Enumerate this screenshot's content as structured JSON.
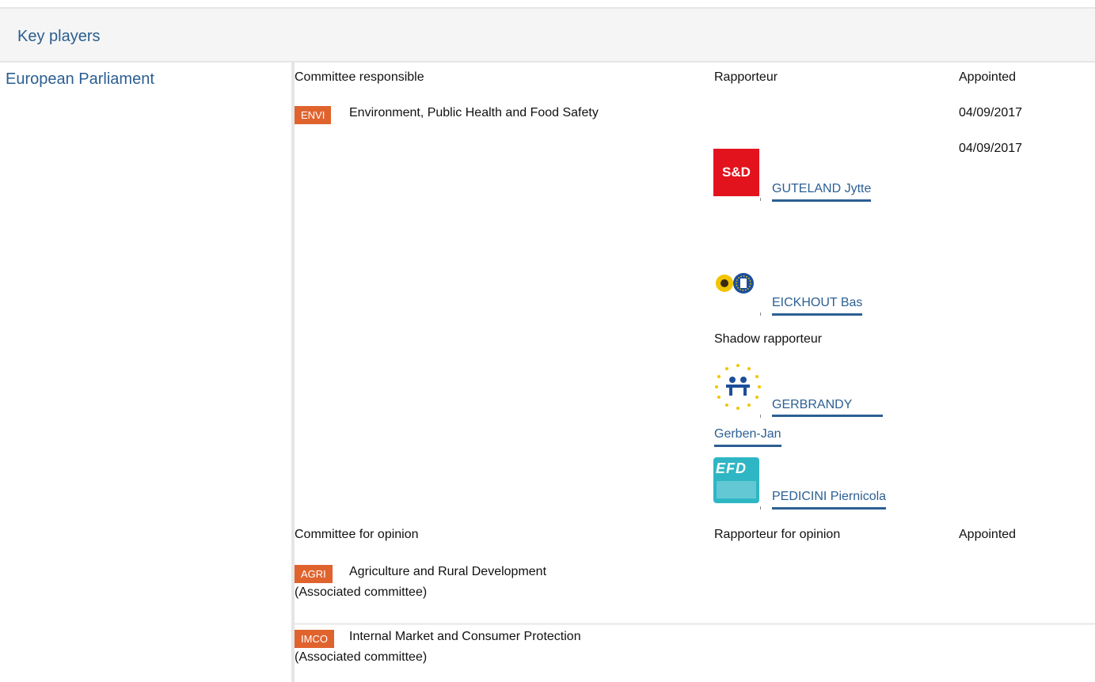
{
  "header": {
    "title": "Key players"
  },
  "institution": {
    "name": "European Parliament"
  },
  "responsible": {
    "committee_col": "Committee responsible",
    "rapporteur_col": "Rapporteur",
    "appointed_col": "Appointed",
    "committee": {
      "code": "ENVI",
      "name": "Environment, Public Health and Food Safety"
    },
    "dates": [
      "04/09/2017",
      "04/09/2017"
    ],
    "rapporteurs": [
      {
        "name": "GUTELAND Jytte",
        "logo": "S&D"
      },
      {
        "name": "EICKHOUT Bas",
        "logo": "greens-efa-logo"
      }
    ],
    "shadow_label": "Shadow rapporteur",
    "shadows": [
      {
        "name_line1": "GERBRANDY",
        "name_line2": "Gerben-Jan",
        "logo": "alde-logo"
      },
      {
        "name": "PEDICINI Piernicola",
        "logo": "EFD"
      }
    ]
  },
  "opinion": {
    "committee_col": "Committee for opinion",
    "rapporteur_col": "Rapporteur for opinion",
    "appointed_col": "Appointed",
    "committees": [
      {
        "code": "AGRI",
        "name": "Agriculture and Rural Development",
        "note": "(Associated committee)"
      },
      {
        "code": "IMCO",
        "name": "Internal Market and Consumer Protection",
        "note": "(Associated committee)"
      }
    ]
  },
  "colors": {
    "accent": "#2b5e91",
    "badge": "#e0632e",
    "sd_red": "#e3131e",
    "efd_teal": "#2fb6c4"
  }
}
